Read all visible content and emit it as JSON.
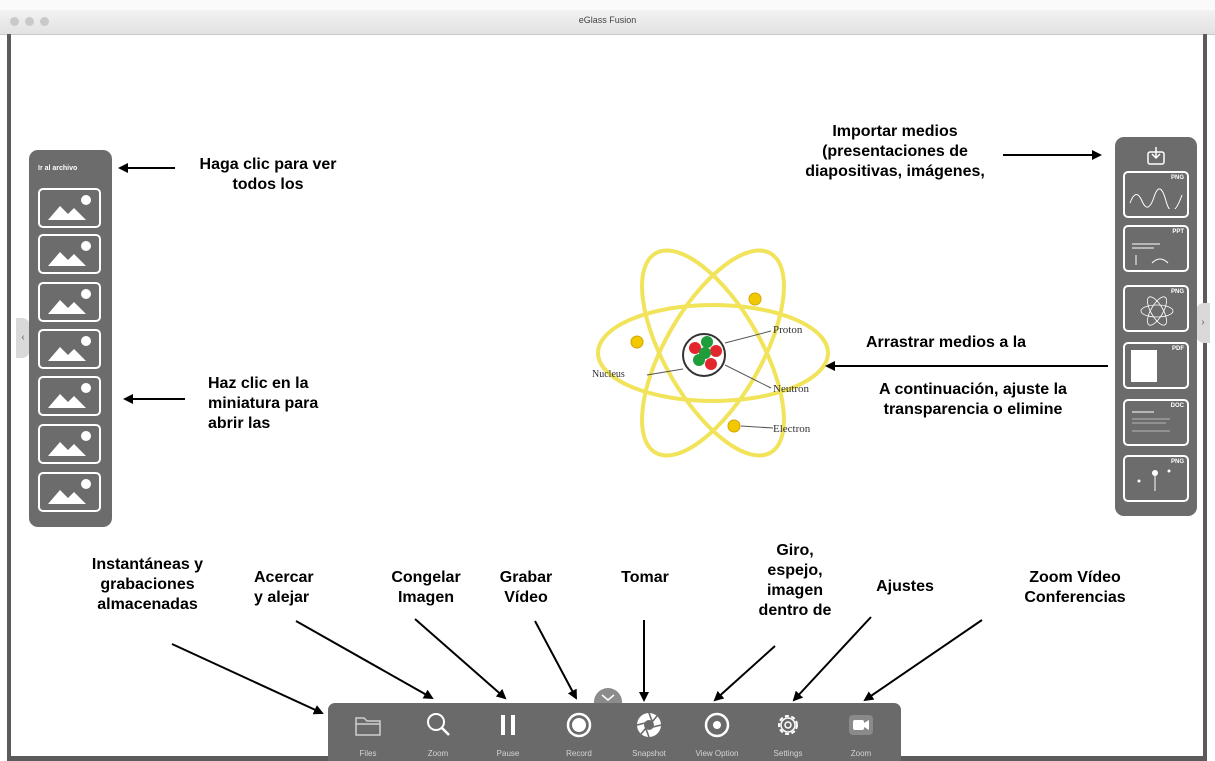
{
  "window": {
    "title": "eGlass Fusion"
  },
  "left_panel": {
    "title": "Ir al archivo"
  },
  "right_panel": {
    "thumbnails": [
      {
        "tag": "PNG"
      },
      {
        "tag": "PPT"
      },
      {
        "tag": "PNG"
      },
      {
        "tag": "PDF"
      },
      {
        "tag": "DOC"
      },
      {
        "tag": "PNG"
      }
    ]
  },
  "diagram": {
    "labels": {
      "proton": "Proton",
      "neutron": "Neutron",
      "nucleus": "Nucleus",
      "electron": "Electron"
    },
    "colors": {
      "orbit": "#f1e35a",
      "electron": "#f2c800",
      "proton": "#e3262d",
      "neutron": "#1f9d3b"
    }
  },
  "annotations": {
    "ir_archivo": [
      "Haga clic para ver",
      "todos los"
    ],
    "miniatura": [
      "Haz clic en la",
      "miniatura para",
      "abrir las"
    ],
    "importar": [
      "Importar medios",
      "(presentaciones de",
      "diapositivas, imágenes,"
    ],
    "arrastrar": "Arrastrar medios a la",
    "continuacion": [
      "A continuación, ajuste la",
      "transparencia o elimine"
    ],
    "instantaneas": [
      "Instantáneas y",
      "grabaciones",
      "almacenadas"
    ],
    "acercar": [
      "Acercar",
      "y alejar"
    ],
    "congelar": [
      "Congelar",
      "Imagen"
    ],
    "grabar": [
      "Grabar",
      "Vídeo"
    ],
    "tomar": "Tomar",
    "giro": [
      "Giro,",
      "espejo,",
      "imagen",
      "dentro de"
    ],
    "ajustes": "Ajustes",
    "zoom_video": [
      "Zoom Vídeo",
      "Conferencias"
    ]
  },
  "toolbar": {
    "files": "Files",
    "zoom": "Zoom",
    "pause": "Pause",
    "record": "Record",
    "snapshot": "Snapshot",
    "view_option": "View Option",
    "settings": "Settings",
    "zoom_meeting": "Zoom"
  },
  "colors": {
    "panel": "#6c6c6c",
    "toolbar": "#6a6a6a",
    "frame": "#5b5b5b",
    "text": "#000000"
  }
}
